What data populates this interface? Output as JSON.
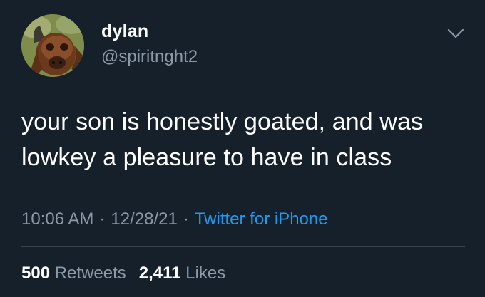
{
  "author": {
    "display_name": "dylan",
    "handle": "@spiritnght2",
    "avatar_icon": "highland-cow-avatar"
  },
  "menu": {
    "icon": "chevron-down-icon"
  },
  "tweet": {
    "text_line1": "your son is honestly goated, and was",
    "text_line2": "lowkey a pleasure to have in class"
  },
  "meta": {
    "time": "10:06 AM",
    "separator": "·",
    "date": "12/28/21",
    "source": "Twitter for iPhone"
  },
  "stats": {
    "retweets_count": "500",
    "retweets_label": "Retweets",
    "likes_count": "2,411",
    "likes_label": "Likes"
  },
  "colors": {
    "background": "#15202b",
    "primary_text": "#ffffff",
    "secondary_text": "#8b98a5",
    "link": "#1d9bf0",
    "divider": "#38444d"
  }
}
